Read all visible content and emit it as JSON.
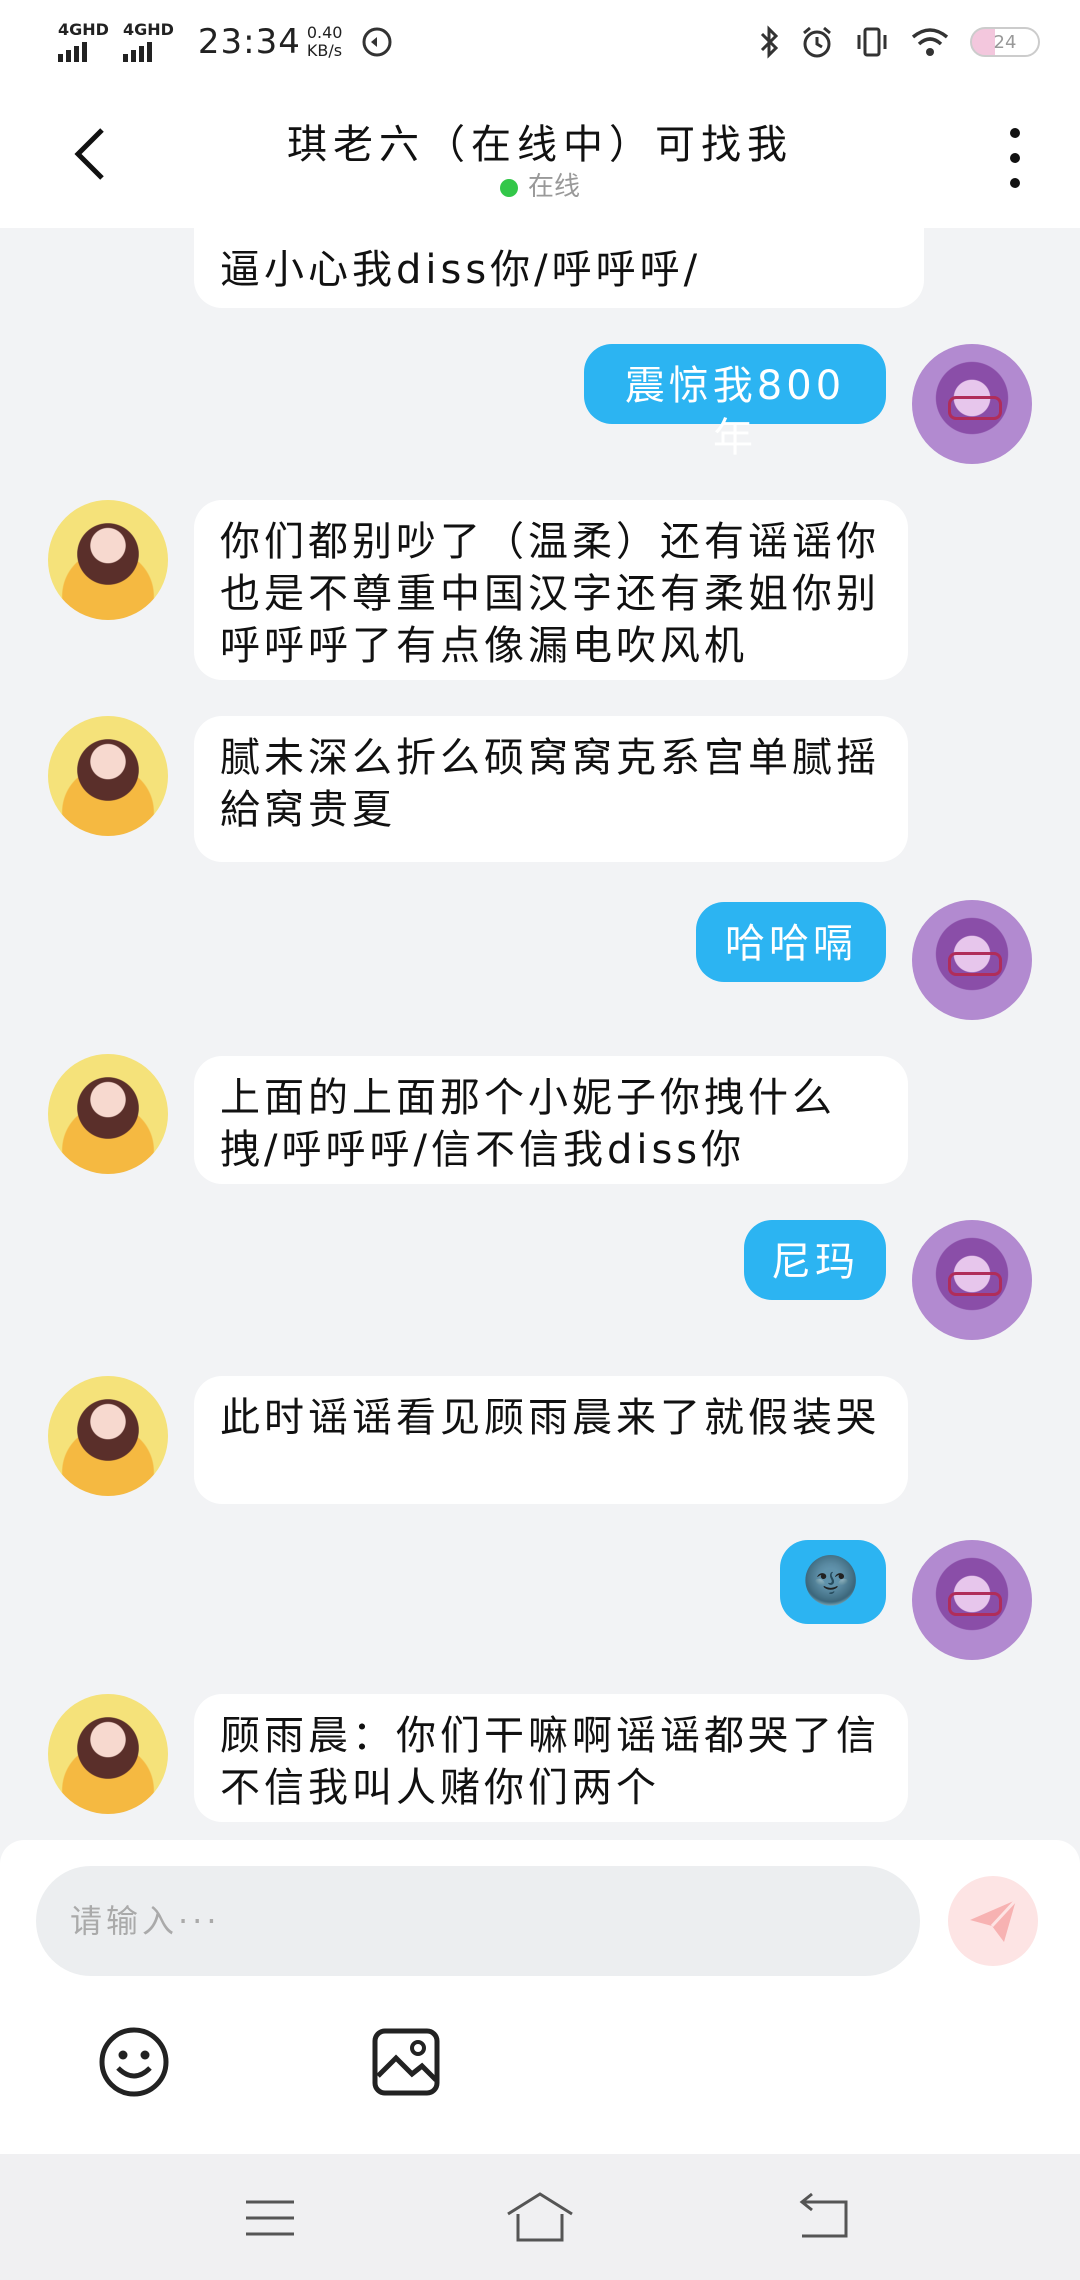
{
  "status_bar": {
    "sim1": "4GHD",
    "sim2": "4GHD",
    "time": "23:34",
    "speed_value": "0.40",
    "speed_unit": "KB/s",
    "battery": "24"
  },
  "header": {
    "title": "琪老六（在线中）可找我",
    "status": "在线"
  },
  "messages": [
    {
      "side": "in",
      "text": "逼小心我diss你/呼呼呼/"
    },
    {
      "side": "out",
      "text": "震惊我800年"
    },
    {
      "side": "in",
      "text": "你们都别吵了（温柔）还有谣谣你也是不尊重中国汉字还有柔姐你别呼呼呼了有点像漏电吹风机"
    },
    {
      "side": "in",
      "text": "腻未深么折么硕窝窝克系宫单腻摇給窝贵夏"
    },
    {
      "side": "out",
      "text": "哈哈嗝"
    },
    {
      "side": "in",
      "text": "上面的上面那个小妮子你拽什么拽/呼呼呼/信不信我diss你"
    },
    {
      "side": "out",
      "text": "尼玛"
    },
    {
      "side": "in",
      "text": "此时谣谣看见顾雨晨来了就假装哭"
    },
    {
      "side": "out",
      "text": "🌚"
    },
    {
      "side": "in",
      "text": "顾雨晨：你们干嘛啊谣谣都哭了信不信我叫人赌你们两个"
    }
  ],
  "composer": {
    "placeholder": "请输入···"
  },
  "colors": {
    "outgoing_bubble": "#2cb4f2",
    "incoming_bubble": "#ffffff",
    "background": "#f2f3f5",
    "online_dot": "#33c749"
  }
}
